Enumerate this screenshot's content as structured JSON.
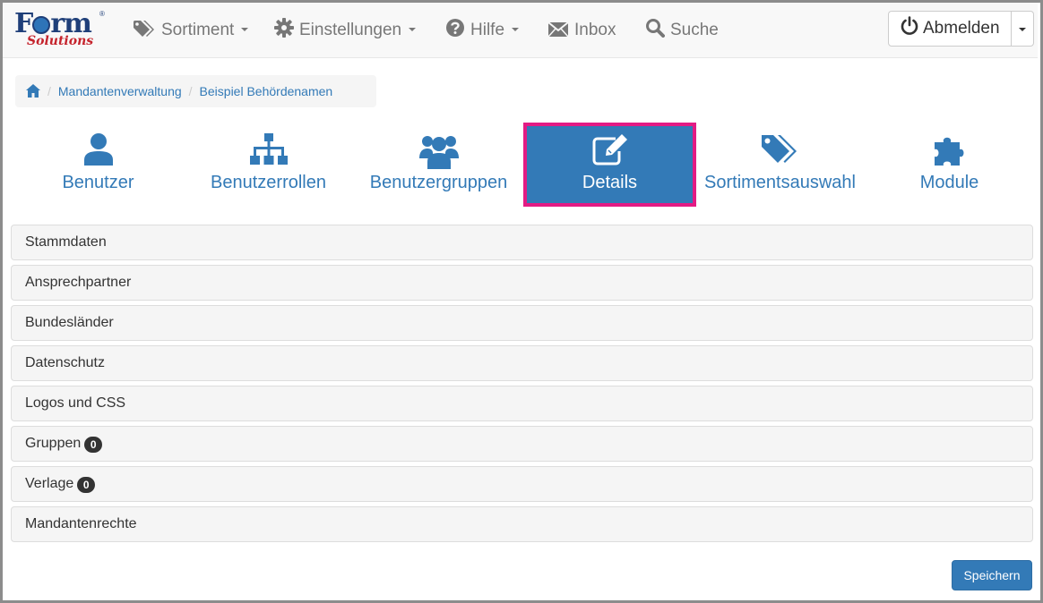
{
  "brand": {
    "logo_word": "Form",
    "logo_sub": "Solutions",
    "registered": "®"
  },
  "nav": {
    "sortiment": {
      "label": "Sortiment",
      "icon": "tags-icon"
    },
    "einstellungen": {
      "label": "Einstellungen",
      "icon": "gear-icon"
    },
    "hilfe": {
      "label": "Hilfe",
      "icon": "question-circle-icon"
    },
    "inbox": {
      "label": "Inbox",
      "icon": "envelope-icon"
    },
    "suche": {
      "label": "Suche",
      "icon": "search-icon"
    },
    "logout": {
      "label": "Abmelden",
      "icon": "power-icon"
    }
  },
  "breadcrumb": {
    "home_icon": "home-icon",
    "items": [
      "Mandantenverwaltung",
      "Beispiel Behördenamen"
    ]
  },
  "tiles": [
    {
      "label": "Benutzer",
      "icon": "user-icon",
      "active": false
    },
    {
      "label": "Benutzerrollen",
      "icon": "sitemap-icon",
      "active": false
    },
    {
      "label": "Benutzergruppen",
      "icon": "users-icon",
      "active": false
    },
    {
      "label": "Details",
      "icon": "edit-icon",
      "active": true
    },
    {
      "label": "Sortimentsauswahl",
      "icon": "tags-icon",
      "active": false
    },
    {
      "label": "Module",
      "icon": "puzzle-icon",
      "active": false
    }
  ],
  "panels": [
    {
      "label": "Stammdaten"
    },
    {
      "label": "Ansprechpartner"
    },
    {
      "label": "Bundesländer"
    },
    {
      "label": "Datenschutz"
    },
    {
      "label": "Logos und CSS"
    },
    {
      "label": "Gruppen",
      "badge": "0"
    },
    {
      "label": "Verlage",
      "badge": "0"
    },
    {
      "label": "Mandantenrechte"
    }
  ],
  "actions": {
    "save_label": "Speichern"
  },
  "colors": {
    "primary": "#337ab7",
    "highlight": "#e31b84",
    "nav_text": "#777777"
  }
}
